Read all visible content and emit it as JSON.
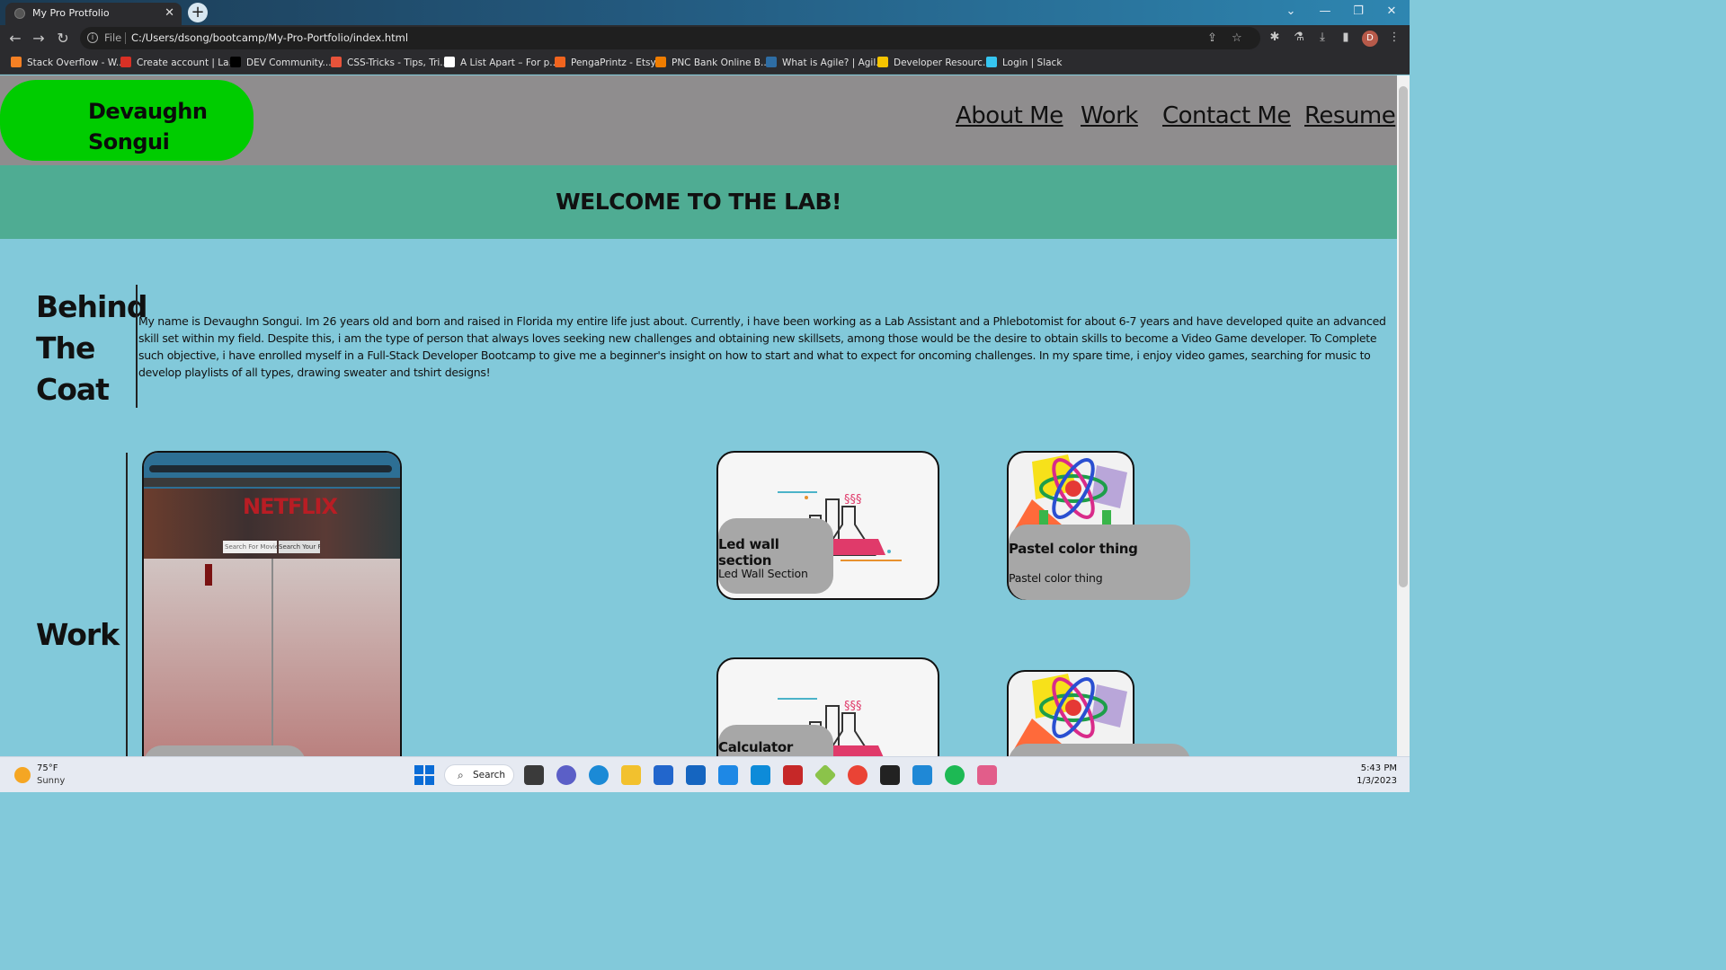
{
  "browser": {
    "tab_title": "My Pro Protfolio",
    "tab_close": "✕",
    "new_tab": "+",
    "scheme": "File",
    "url": "C:/Users/dsong/bootcamp/My-Pro-Portfolio/index.html",
    "profile_initial": "D",
    "bookmarks": [
      {
        "label": "Stack Overflow - W...",
        "color": "#f48024"
      },
      {
        "label": "Create account | La...",
        "color": "#d93025"
      },
      {
        "label": "DEV Community...",
        "color": "#000000"
      },
      {
        "label": "CSS-Tricks - Tips, Tri...",
        "color": "#e8533a"
      },
      {
        "label": "A List Apart – For p...",
        "color": "#ffffff"
      },
      {
        "label": "PengaPrintz - Etsy",
        "color": "#f1641e"
      },
      {
        "label": "PNC Bank Online B...",
        "color": "#ef7d00"
      },
      {
        "label": "What is Agile? | Agil...",
        "color": "#2e6da4"
      },
      {
        "label": "Developer Resourc...",
        "color": "#f5c400"
      },
      {
        "label": "Login | Slack",
        "color": "#36c5f0"
      }
    ]
  },
  "site": {
    "logo_line1": "Devaughn",
    "logo_line2": "Songui",
    "nav": [
      "About Me",
      "Work",
      "Contact Me",
      "Resume"
    ],
    "banner": "WELCOME TO THE LAB!",
    "about_title_lines": [
      "Behind",
      "The",
      "Coat"
    ],
    "about_text": "My name is Devaughn Songui. Im 26 years old and born and raised in Florida my entire life just about. Currently, i have been working as a Lab Assistant and a Phlebotomist for about 6-7 years and have developed quite an advanced skill set within my field. Despite this, i am the type of person that always loves seeking new challenges and obtaining new skillsets, among those would be the desire to obtain skills to become a Video Game developer. To Complete such objective, i have enrolled myself in a Full-Stack Developer Bootcamp to give me a beginner's insight on how to start and what to expect for oncoming challenges. In my spare time, i enjoy video games, searching for music to develop playlists of all types, drawing sweater and tshirt designs!",
    "work_title": "Work",
    "screenshot_brand": "NETFLIX",
    "screenshot_search_placeholder": "Search For Movies",
    "screenshot_search_button": "Search Your Reviews",
    "cards": [
      {
        "title": "Led wall section",
        "desc": "Led Wall Section"
      },
      {
        "title": "Pastel color thing",
        "desc": "Pastel color thing"
      },
      {
        "title": "Calculator",
        "desc": ""
      }
    ]
  },
  "taskbar": {
    "weather_temp": "75°F",
    "weather_desc": "Sunny",
    "search_label": "Search",
    "time": "5:43 PM",
    "date": "1/3/2023"
  }
}
